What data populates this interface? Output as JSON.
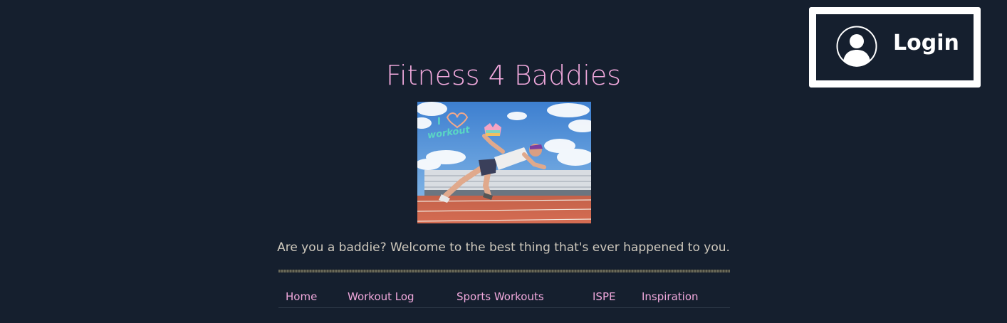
{
  "login": {
    "label": "Login",
    "icon": "user-avatar-icon"
  },
  "header": {
    "title": "Fitness 4 Baddies"
  },
  "hero": {
    "overlay_text_1": "I",
    "overlay_text_2": "workout",
    "icon": "sprinter-photo"
  },
  "tagline": "Are you a baddie? Welcome to the best thing that's ever happened to you.",
  "nav": {
    "items": [
      {
        "label": "Home"
      },
      {
        "label": "Workout Log"
      },
      {
        "label": "Sports Workouts"
      },
      {
        "label": "ISPE"
      },
      {
        "label": "Inspiration"
      }
    ]
  },
  "colors": {
    "background": "#151f2e",
    "accent_pink": "#f0a8dc",
    "tagline_text": "#cfc9bd",
    "login_border": "#ffffff"
  }
}
